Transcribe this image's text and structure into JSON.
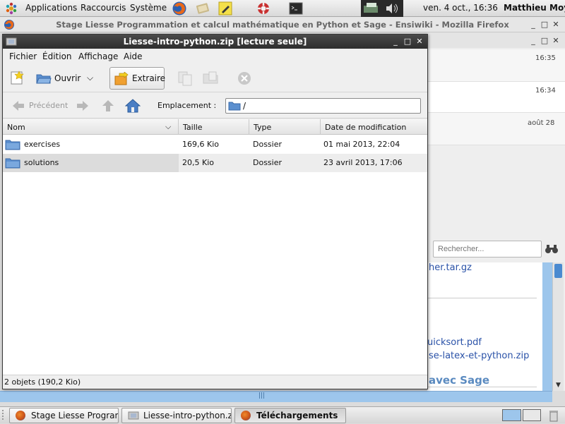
{
  "top_panel": {
    "menus": [
      "Applications",
      "Raccourcis",
      "Système"
    ],
    "clock": "ven.  4 oct., 16:36",
    "user": "Matthieu Moy"
  },
  "firefox": {
    "title": "Stage Liesse Programmation et calcul mathématique en Python et Sage - Ensiwiki - Mozilla Firefox",
    "times": [
      "16:35",
      "16:34",
      "août 28"
    ],
    "search_placeholder": "Rechercher...",
    "links": [
      "her.tar.gz",
      "uicksort.pdf",
      "se-latex-et-python.zip"
    ],
    "heading": "avec Sage"
  },
  "archive": {
    "title": "Liesse-intro-python.zip [lecture seule]",
    "menu": [
      "Fichier",
      "Édition",
      "Affichage",
      "Aide"
    ],
    "toolbar": {
      "open": "Ouvrir",
      "extract": "Extraire"
    },
    "locbar": {
      "back": "Précédent",
      "location_label": "Emplacement :",
      "location_value": "/"
    },
    "columns": [
      "Nom",
      "Taille",
      "Type",
      "Date de modification"
    ],
    "rows": [
      {
        "name": "exercises",
        "size": "169,6 Kio",
        "type": "Dossier",
        "date": "01 mai 2013, 22:04"
      },
      {
        "name": "solutions",
        "size": "20,5 Kio",
        "type": "Dossier",
        "date": "23 avril 2013, 17:06"
      }
    ],
    "status": "2 objets (190,2 Kio)"
  },
  "taskbar": {
    "tasks": [
      "Stage Liesse Program...",
      "Liesse-intro-python.z...",
      "Téléchargements"
    ]
  },
  "colors": {
    "accent_blue": "#9dc6ec",
    "link_blue": "#2a52a8",
    "folder_blue": "#5b8fcf",
    "title_dark": "#3a3a3a"
  }
}
